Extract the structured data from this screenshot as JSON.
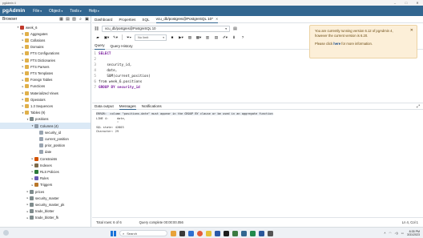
{
  "window": {
    "title": "pgAdmin 4"
  },
  "menubar": {
    "logo_text": "pgAdmin",
    "menus": [
      {
        "label": "File"
      },
      {
        "label": "Object"
      },
      {
        "label": "Tools"
      },
      {
        "label": "Help"
      }
    ]
  },
  "browser": {
    "title": "Browser",
    "tree": [
      {
        "label": "week_6",
        "indent": 3,
        "icon": "database-icon",
        "expanded": true
      },
      {
        "label": "Aggregates",
        "indent": 4,
        "icon": "folder-icon"
      },
      {
        "label": "Collations",
        "indent": 4,
        "icon": "folder-icon"
      },
      {
        "label": "Domains",
        "indent": 4,
        "icon": "folder-icon"
      },
      {
        "label": "FTS Configurations",
        "indent": 4,
        "icon": "folder-icon"
      },
      {
        "label": "FTS Dictionaries",
        "indent": 4,
        "icon": "folder-icon"
      },
      {
        "label": "FTS Parsers",
        "indent": 4,
        "icon": "folder-icon"
      },
      {
        "label": "FTS Templates",
        "indent": 4,
        "icon": "folder-icon"
      },
      {
        "label": "Foreign Tables",
        "indent": 4,
        "icon": "folder-icon"
      },
      {
        "label": "Functions",
        "indent": 4,
        "icon": "folder-icon"
      },
      {
        "label": "Materialized Views",
        "indent": 4,
        "icon": "folder-icon"
      },
      {
        "label": "Operators",
        "indent": 4,
        "icon": "folder-icon"
      },
      {
        "label": "1.3 Sequences",
        "indent": 4,
        "icon": "folder-icon"
      },
      {
        "label": "Tables (9)",
        "indent": 4,
        "icon": "folder-icon",
        "expanded": true
      },
      {
        "label": "positions",
        "indent": 5,
        "icon": "table-icon",
        "expanded": true
      },
      {
        "label": "Columns (4)",
        "indent": 6,
        "icon": "columns-icon",
        "expanded": true,
        "selected": true
      },
      {
        "label": "security_id",
        "indent": 7,
        "icon": "column-icon"
      },
      {
        "label": "current_position",
        "indent": 7,
        "icon": "column-icon"
      },
      {
        "label": "prior_position",
        "indent": 7,
        "icon": "column-icon"
      },
      {
        "label": "date",
        "indent": 7,
        "icon": "column-icon"
      },
      {
        "label": "Constraints",
        "indent": 6,
        "icon": "constraints-icon"
      },
      {
        "label": "Indexes",
        "indent": 6,
        "icon": "indexes-icon"
      },
      {
        "label": "RLS Policies",
        "indent": 6,
        "icon": "policies-icon"
      },
      {
        "label": "Rules",
        "indent": 6,
        "icon": "rules-icon"
      },
      {
        "label": "Triggers",
        "indent": 6,
        "icon": "triggers-icon"
      },
      {
        "label": "prices",
        "indent": 5,
        "icon": "table-icon"
      },
      {
        "label": "security_master",
        "indent": 5,
        "icon": "table-icon"
      },
      {
        "label": "security_master_pk",
        "indent": 5,
        "icon": "table-icon"
      },
      {
        "label": "trade_blotter",
        "indent": 5,
        "icon": "table-icon"
      },
      {
        "label": "trade_blotter_fk",
        "indent": 5,
        "icon": "table-icon"
      }
    ]
  },
  "tabs": [
    {
      "label": "Dashboard"
    },
    {
      "label": "Properties"
    },
    {
      "label": "SQL"
    },
    {
      "label": "vcu_db/postgres@PostgreSQL 10*",
      "active": true
    }
  ],
  "connection": {
    "value": "vcu_db/postgres@PostgreSQL 10"
  },
  "toolbar": {
    "limit_value": "No limit"
  },
  "subtabs": [
    {
      "label": "Query",
      "active": true
    },
    {
      "label": "Query History"
    }
  ],
  "editor": {
    "lines": [
      {
        "n": "1",
        "text": "SELECT",
        "kind": "kw"
      },
      {
        "n": "2",
        "text": "",
        "kind": "plain"
      },
      {
        "n": "3",
        "text": "    security_id,",
        "kind": "plain"
      },
      {
        "n": "4",
        "text": "    date,",
        "kind": "plain"
      },
      {
        "n": "5",
        "text": "    SUM(current_position)",
        "kind": "plain"
      },
      {
        "n": "6",
        "text": "from week_6.positions",
        "kind": "plain"
      },
      {
        "n": "7",
        "text": "GROUP BY security_id",
        "kind": "plain"
      }
    ]
  },
  "results_tabs": [
    {
      "label": "Data output"
    },
    {
      "label": "Messages",
      "active": true
    },
    {
      "label": "Notifications"
    }
  ],
  "messages": [
    "ERROR:  column \"positions.date\" must appear in the GROUP BY clause or be used in an aggregate function",
    "LINE 4:     date,",
    "            ^",
    "SQL state: 42803",
    "Character: 29"
  ],
  "status": {
    "total_rows": "Total rows: 6 of 6",
    "query_complete": "Query complete 00:00:00.056",
    "cursor": "Ln 4, Col 1"
  },
  "toast": {
    "line1": "You are currently running version 6.12 of pgAdmin 4,",
    "line2": "however the current version is 6.20.",
    "line3_pre": "Please click ",
    "line3_link": "here",
    "line3_post": " for more information."
  },
  "taskbar": {
    "search_placeholder": "Search",
    "time": "8:35 PM",
    "date": "3/31/2023"
  },
  "colors": {
    "header_blue": "#326690",
    "toast_bg": "#fcefd8",
    "selected_row": "#dbe9f6"
  }
}
